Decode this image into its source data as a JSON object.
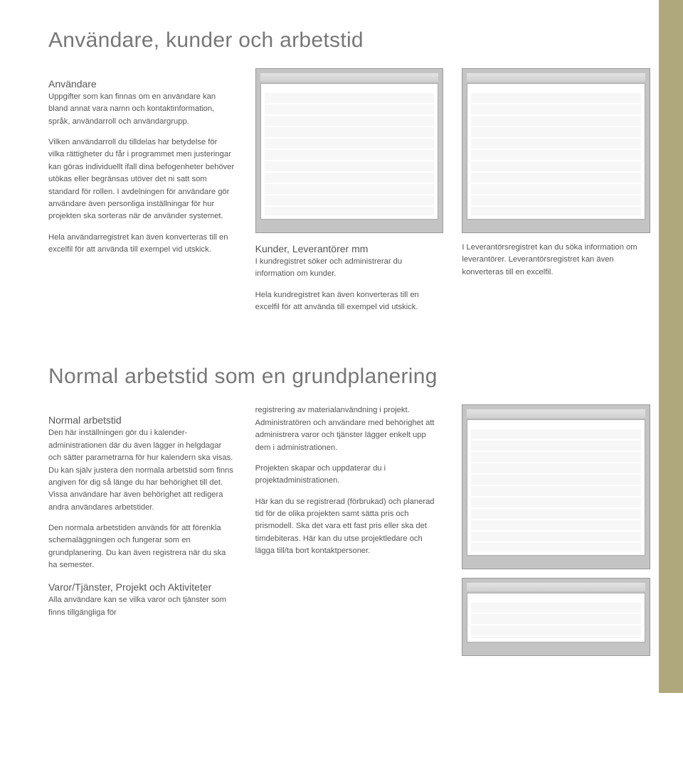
{
  "section1": {
    "title": "Användare, kunder och arbetstid",
    "col1": {
      "h1": "Användare",
      "p1": "Uppgifter som kan finnas om en användare kan bland annat vara namn och kontaktinformation, språk, användarroll och användargrupp.",
      "p2": "Vilken användarroll du tilldelas har betydelse för vilka rättigheter du får i programmet men justeringar kan göras individuellt ifall dina befogenheter behöver utökas eller begränsas utöver det ni satt som standard för rollen. I avdelningen för användare gör användare även personliga inställningar för hur projekten ska sorteras när de använder systemet.",
      "p3": "Hela användarregistret kan även konverteras till en excelfil för att använda till exempel vid utskick."
    },
    "col2": {
      "h1": "Kunder, Leverantörer mm",
      "p1": "I kundregistret söker och administrerar du information om kunder.",
      "p2": "Hela kundregistret kan även konverteras till en excelfil för att använda till exempel vid utskick."
    },
    "col3": {
      "p1": "I Leverantörsregistret kan du söka information om leverantörer. Leverantörsregistret kan även konverteras till en excelfil."
    }
  },
  "section2": {
    "title": "Normal arbetstid som en grundplanering",
    "col1": {
      "h1": "Normal arbetstid",
      "p1": "Den här inställningen gör du i kalender-administrationen där du även lägger in helgdagar och sätter parametrarna för hur kalendern ska visas. Du kan själv justera den normala arbetstid som finns angiven för dig så länge du har behörighet till det. Vissa användare har även behörighet att redigera andra användares arbetstider.",
      "p2": "Den normala arbetstiden används för att förenkla schemaläggningen och fungerar som en grundplanering. Du kan även registrera när du ska ha semester.",
      "h2": "Varor/Tjänster, Projekt och Aktiviteter",
      "p3": "Alla användare kan se vilka varor och tjänster som finns tillgängliga för"
    },
    "col2": {
      "p1": "registrering av materialanvändning i projekt. Administratören och användare med behörighet att administrera varor och tjänster lägger enkelt upp dem i administrationen.",
      "p2": "Projekten skapar och uppdaterar du i projektadministrationen.",
      "p3": "Här kan du se registrerad (förbrukad) och planerad tid för de olika projekten samt sätta pris och prismodell. Ska det vara ett fast pris eller ska det timdebiteras. Här kan du utse projektledare och lägga till/ta bort kontaktpersoner."
    }
  }
}
